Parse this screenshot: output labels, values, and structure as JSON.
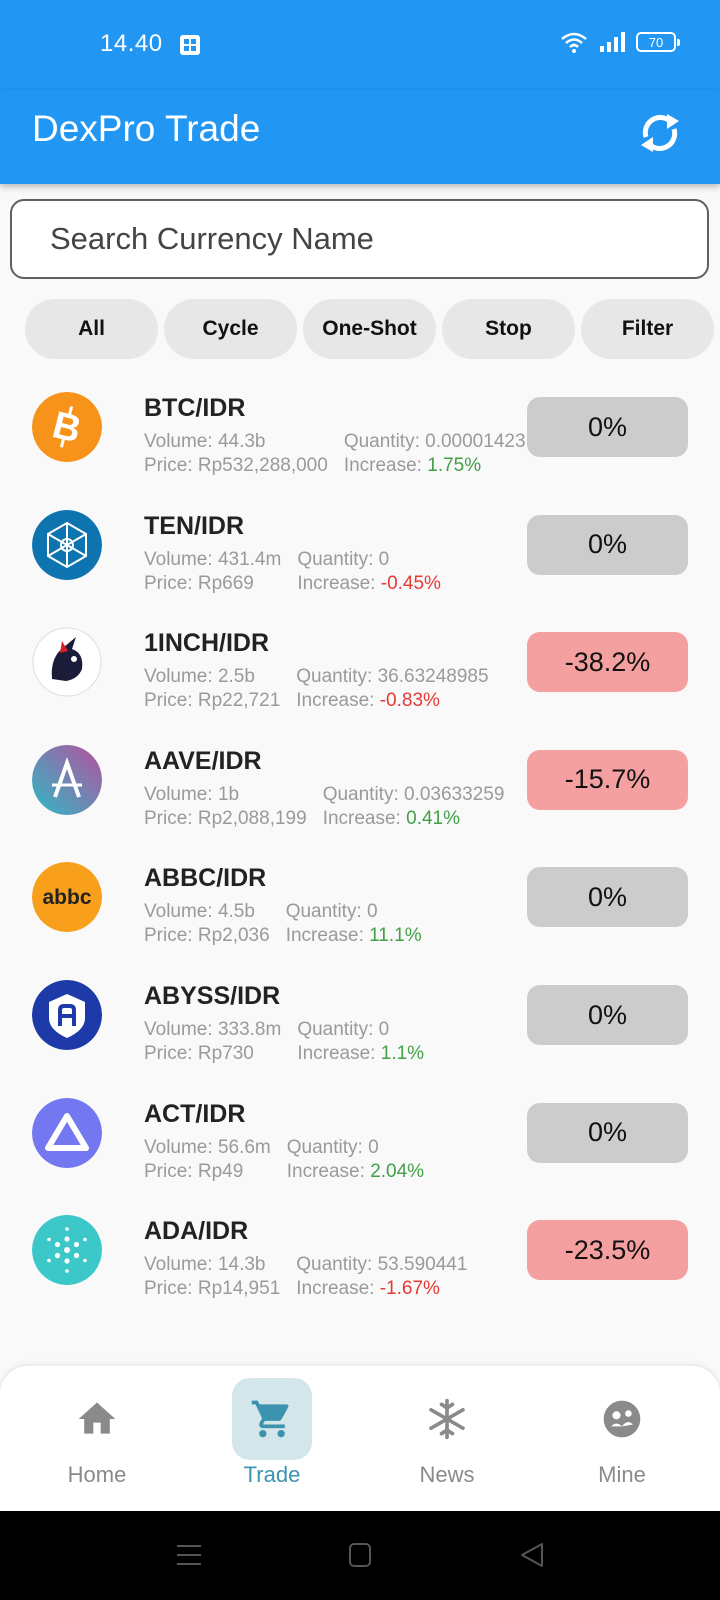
{
  "status": {
    "time": "14.40",
    "battery": "70"
  },
  "app": {
    "title": "DexPro Trade"
  },
  "search": {
    "placeholder": "Search Currency Name"
  },
  "filters": [
    "All",
    "Cycle",
    "One-Shot",
    "Stop",
    "Filter"
  ],
  "labels": {
    "volume": "Volume: ",
    "quantity": "Quantity: ",
    "price": "Price: ",
    "increase": "Increase: "
  },
  "coins": [
    {
      "pair": "BTC/IDR",
      "volume": "44.3b",
      "quantity": "0.00001423",
      "price": "Rp532,288,000",
      "increase": "1.75%",
      "trend": "pos",
      "pct": "0%",
      "pct_style": "gray",
      "icon": "bitcoin-icon",
      "color": "#f7931a"
    },
    {
      "pair": "TEN/IDR",
      "volume": "431.4m",
      "quantity": "0",
      "price": "Rp669",
      "increase": "-0.45%",
      "trend": "neg",
      "pct": "0%",
      "pct_style": "gray",
      "icon": "tokenomy-icon",
      "color": "#0d74b0"
    },
    {
      "pair": "1INCH/IDR",
      "volume": "2.5b",
      "quantity": "36.63248985",
      "price": "Rp22,721",
      "increase": "-0.83%",
      "trend": "neg",
      "pct": "-38.2%",
      "pct_style": "red",
      "icon": "unicorn-icon",
      "color": "#ffffff"
    },
    {
      "pair": "AAVE/IDR",
      "volume": "1b",
      "quantity": "0.03633259",
      "price": "Rp2,088,199",
      "increase": "0.41%",
      "trend": "pos",
      "pct": "-15.7%",
      "pct_style": "red",
      "icon": "aave-icon",
      "color": "#8b5fbf"
    },
    {
      "pair": "ABBC/IDR",
      "volume": "4.5b",
      "quantity": "0",
      "price": "Rp2,036",
      "increase": "11.1%",
      "trend": "pos",
      "pct": "0%",
      "pct_style": "gray",
      "icon": "abbc-icon",
      "color": "#f89f1b"
    },
    {
      "pair": "ABYSS/IDR",
      "volume": "333.8m",
      "quantity": "0",
      "price": "Rp730",
      "increase": "1.1%",
      "trend": "pos",
      "pct": "0%",
      "pct_style": "gray",
      "icon": "abyss-icon",
      "color": "#1e3aa8"
    },
    {
      "pair": "ACT/IDR",
      "volume": "56.6m",
      "quantity": "0",
      "price": "Rp49",
      "increase": "2.04%",
      "trend": "pos",
      "pct": "0%",
      "pct_style": "gray",
      "icon": "achain-icon",
      "color": "#7378f0"
    },
    {
      "pair": "ADA/IDR",
      "volume": "14.3b",
      "quantity": "53.590441",
      "price": "Rp14,951",
      "increase": "-1.67%",
      "trend": "neg",
      "pct": "-23.5%",
      "pct_style": "red",
      "icon": "cardano-icon",
      "color": "#3cc8c8"
    }
  ],
  "nav": [
    {
      "label": "Home",
      "icon": "home-icon"
    },
    {
      "label": "Trade",
      "icon": "cart-icon",
      "active": true
    },
    {
      "label": "News",
      "icon": "snowflake-icon"
    },
    {
      "label": "Mine",
      "icon": "face-icon"
    }
  ],
  "colors": {
    "primary": "#2196f3",
    "positive": "#43a047",
    "negative": "#e53935",
    "chip": "#e7e7e7",
    "pct_gray": "#cccccc",
    "pct_red": "#f5a0a0",
    "nav_active": "#3b93b0"
  }
}
